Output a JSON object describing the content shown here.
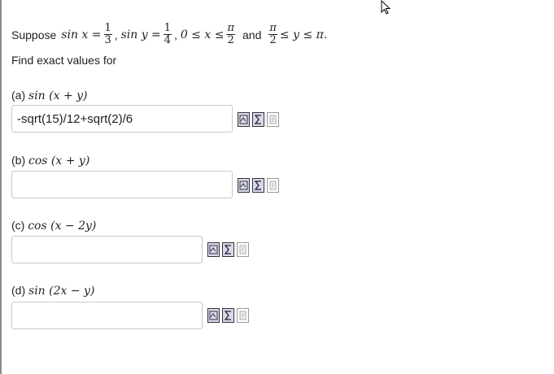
{
  "problem": {
    "intro": "Suppose",
    "sinx_lhs": "sin x =",
    "sinx_num": "1",
    "sinx_den": "3",
    "siny_lhs": "sin y =",
    "siny_num": "1",
    "siny_den": "4",
    "cond1_left": "0 ≤ x ≤",
    "pi_num": "π",
    "pi_den": "2",
    "and_text": "and",
    "cond2_right": "≤ y ≤ π."
  },
  "instruction": "Find exact values for",
  "parts": [
    {
      "label_prefix": "(a)",
      "expr": "sin (x + y)",
      "value": "-sqrt(15)/12+sqrt(2)/6",
      "placeholder": ""
    },
    {
      "label_prefix": "(b)",
      "expr": "cos (x + y)",
      "value": "",
      "placeholder": ""
    },
    {
      "label_prefix": "(c)",
      "expr": "cos (x − 2y)",
      "value": "",
      "placeholder": ""
    },
    {
      "label_prefix": "(d)",
      "expr": "sin (2x − y)",
      "value": "",
      "placeholder": ""
    }
  ],
  "icons": [
    "equation-editor-icon",
    "sigma-palette-icon",
    "preview-icon"
  ]
}
